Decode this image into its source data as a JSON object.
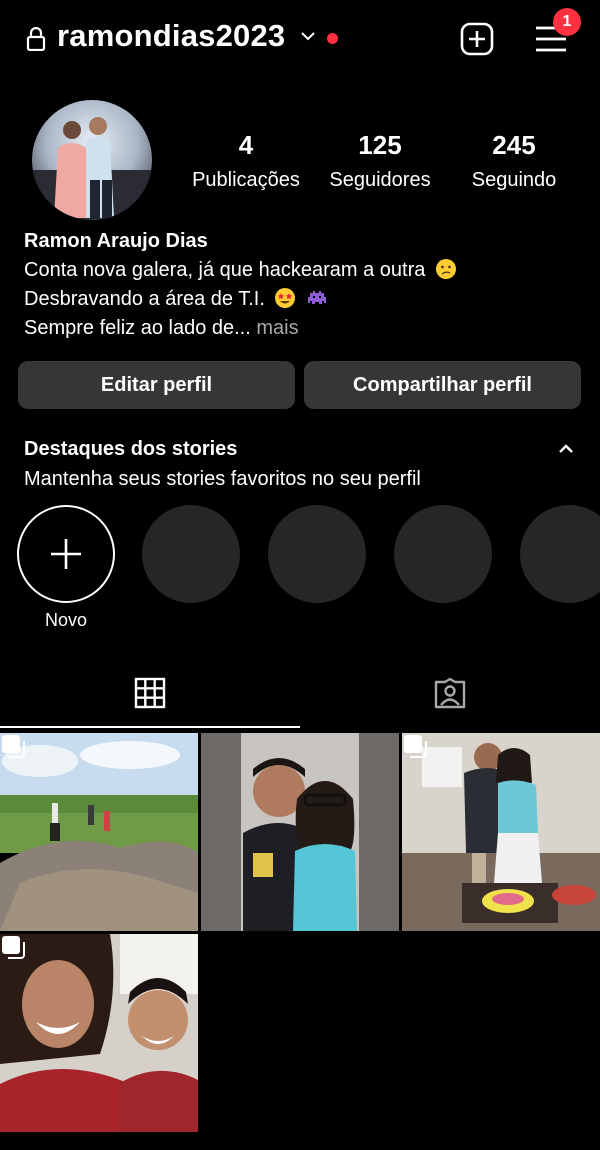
{
  "header": {
    "username": "ramondias2023",
    "notification_badge": "1",
    "icons": [
      "lock-icon",
      "chevron-down-icon",
      "add-post-icon",
      "menu-icon"
    ],
    "accent_red": "#ff3040"
  },
  "profile": {
    "stats": [
      {
        "value": "4",
        "label": "Publicações"
      },
      {
        "value": "125",
        "label": "Seguidores"
      },
      {
        "value": "245",
        "label": "Seguindo"
      }
    ],
    "full_name": "Ramon Araujo Dias",
    "bio_lines": [
      "Conta nova galera, já que hackearam a outra",
      "Desbravando a área de T.I.",
      "Sempre feliz ao lado de..."
    ],
    "more_label": "mais",
    "emojis": [
      "confused-face-emoji",
      "star-struck-emoji",
      "alien-monster-emoji"
    ]
  },
  "actions": {
    "edit_label": "Editar perfil",
    "share_label": "Compartilhar perfil"
  },
  "highlights": {
    "title": "Destaques dos stories",
    "subtitle": "Mantenha seus stories favoritos no seu perfil",
    "new_label": "Novo"
  },
  "tabs": [
    {
      "name": "grid",
      "icon": "grid-icon",
      "active": true
    },
    {
      "name": "tagged",
      "icon": "tagged-person-icon",
      "active": false
    }
  ],
  "posts": [
    {
      "description": "photo",
      "multiple": true
    },
    {
      "description": "photo",
      "multiple": false
    },
    {
      "description": "photo",
      "multiple": true
    },
    {
      "description": "photo",
      "multiple": true
    }
  ]
}
